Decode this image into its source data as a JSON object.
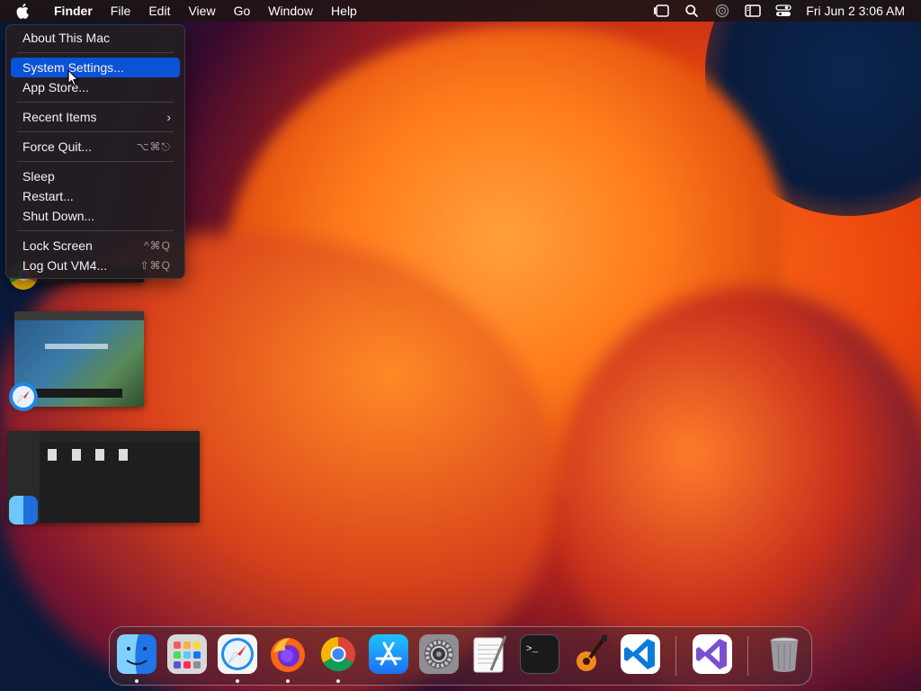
{
  "menubar": {
    "app_name": "Finder",
    "menus": [
      "File",
      "Edit",
      "View",
      "Go",
      "Window",
      "Help"
    ],
    "clock": "Fri Jun 2  3:06 AM",
    "status_icons": [
      "stage-manager-icon",
      "search-icon",
      "airdrop-icon",
      "screen-mirroring-icon",
      "control-center-icon"
    ]
  },
  "apple_menu": {
    "items": [
      {
        "label": "About This Mac",
        "shortcut": ""
      },
      {
        "label": "System Settings...",
        "shortcut": "",
        "highlighted": true
      },
      {
        "label": "App Store...",
        "shortcut": ""
      },
      {
        "label": "Recent Items",
        "shortcut": "",
        "submenu": true
      },
      {
        "label": "Force Quit...",
        "shortcut": "⌥⌘⎋"
      },
      {
        "label": "Sleep",
        "shortcut": ""
      },
      {
        "label": "Restart...",
        "shortcut": ""
      },
      {
        "label": "Shut Down...",
        "shortcut": ""
      },
      {
        "label": "Lock Screen",
        "shortcut": "^⌘Q"
      },
      {
        "label": "Log Out VM4...",
        "shortcut": "⇧⌘Q"
      }
    ],
    "highlight_color": "#0a52d6"
  },
  "stage_manager": [
    "Google Chrome",
    "Safari",
    "Finder"
  ],
  "dock": {
    "apps": [
      "Finder",
      "Launchpad",
      "Safari",
      "Firefox",
      "Google Chrome",
      "App Store",
      "System Settings",
      "TextEdit",
      "Terminal",
      "GarageBand",
      "Visual Studio Code",
      "Visual Studio",
      "Trash"
    ]
  }
}
